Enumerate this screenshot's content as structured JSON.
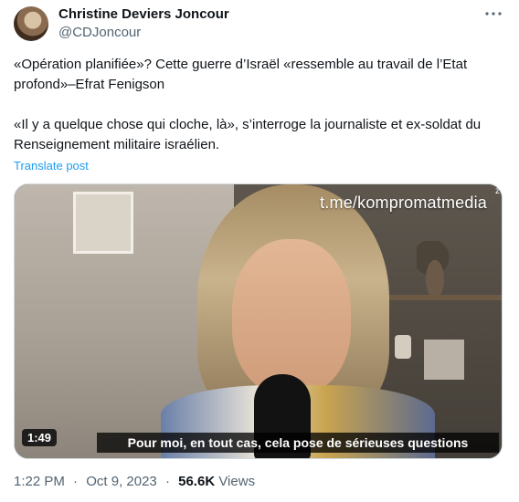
{
  "author": {
    "display_name": "Christine Deviers Joncour",
    "handle": "@CDJoncour"
  },
  "tweet": {
    "paragraph1": "«Opération planifiée»? Cette guerre d’Israël «ressemble au travail de l’Etat profond»–Efrat Fenigson",
    "paragraph2": "«Il y a quelque chose qui cloche, là», s’interroge la journaliste et ex-soldat du Renseignement militaire israélien.",
    "translate_label": "Translate post"
  },
  "media": {
    "watermark": "t.me/kompromatmedia",
    "corner_mark": "z",
    "subtitle": "Pour moi, en tout cas, cela pose de sérieuses questions",
    "duration": "1:49"
  },
  "meta": {
    "time": "1:22 PM",
    "date": "Oct 9, 2023",
    "separator": "·",
    "views_count": "56.6K",
    "views_label": "Views"
  },
  "icons": {
    "more": "more-horizontal-icon"
  },
  "colors": {
    "link": "#1d9bf0",
    "secondary_text": "#536471",
    "primary_text": "#0f1419"
  }
}
